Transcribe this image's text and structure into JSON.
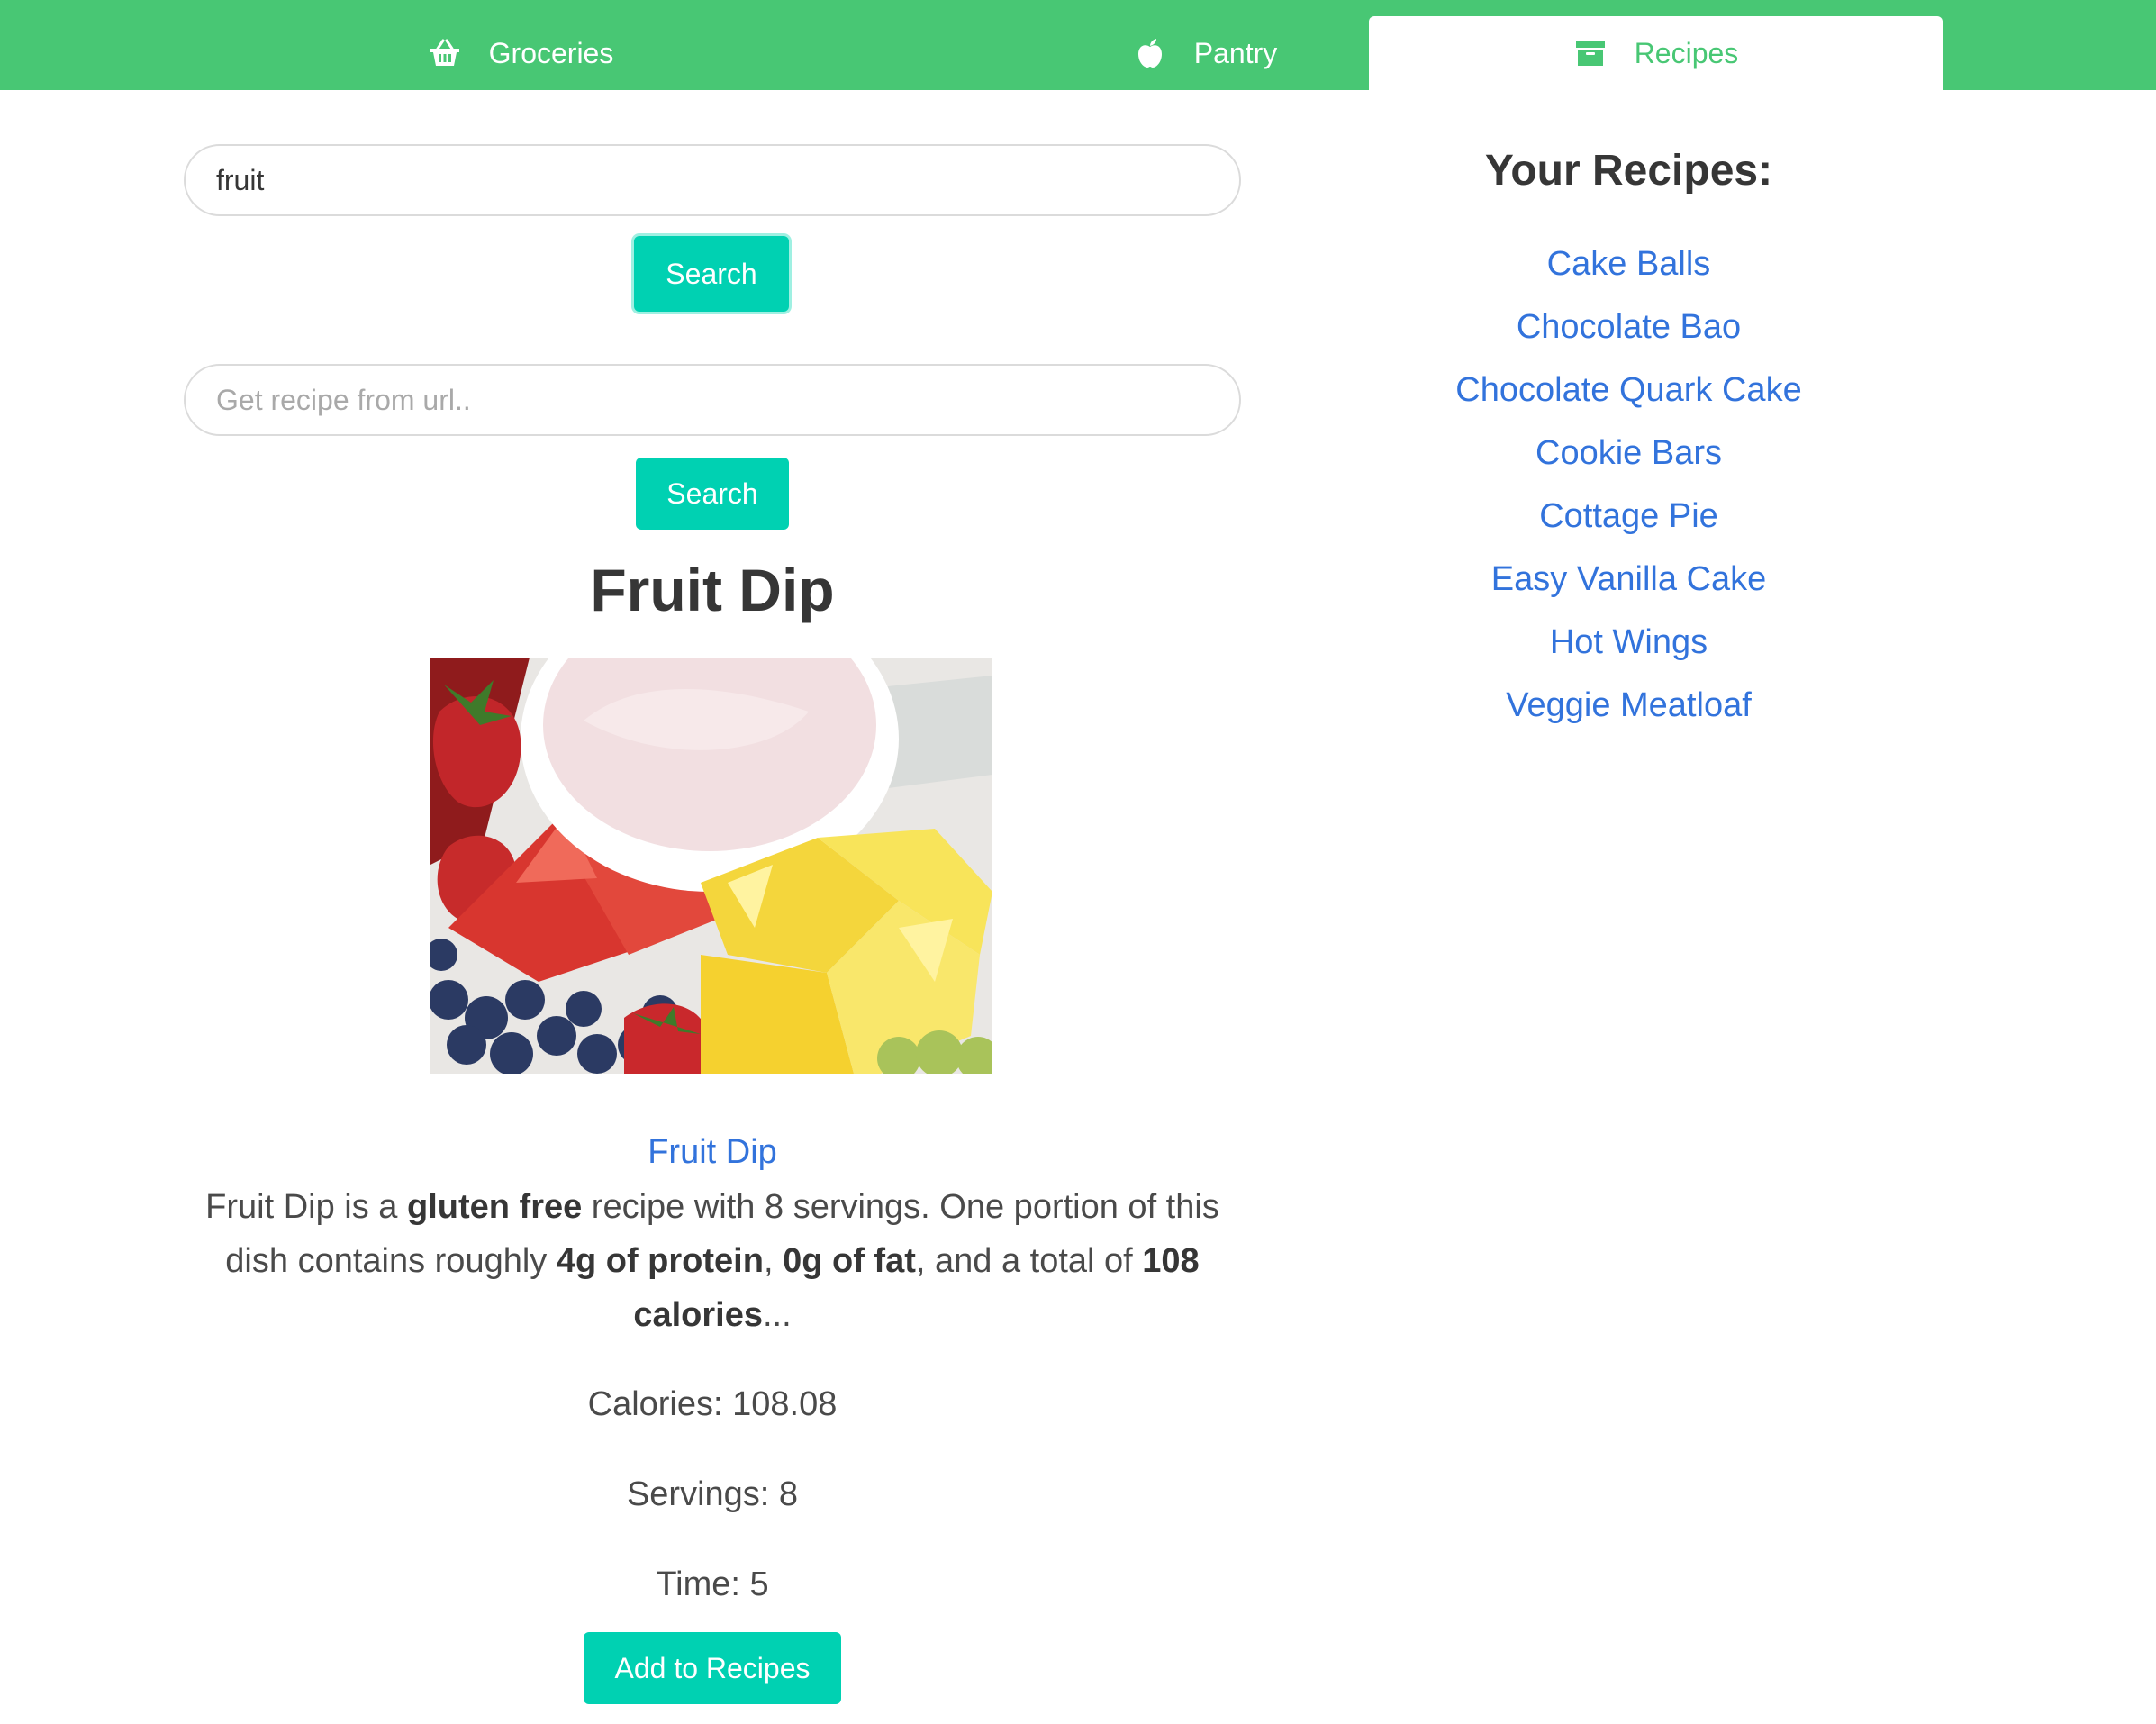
{
  "nav": {
    "tabs": [
      {
        "label": "Groceries",
        "icon": "basket-icon",
        "active": false
      },
      {
        "label": "Pantry",
        "icon": "apple-icon",
        "active": false
      },
      {
        "label": "Recipes",
        "icon": "archive-icon",
        "active": true
      }
    ]
  },
  "search": {
    "value": "fruit",
    "button_label": "Search"
  },
  "url_search": {
    "value": "",
    "placeholder": "Get recipe from url..",
    "button_label": "Search"
  },
  "recipe": {
    "title": "Fruit Dip",
    "image_alt": "fruit-dip-photo",
    "link_label": "Fruit Dip",
    "summary": {
      "t1": "Fruit Dip is a ",
      "b1": "gluten free",
      "t2": " recipe with 8 servings. One portion of this dish contains roughly ",
      "b2": "4g of protein",
      "t3": ", ",
      "b3": "0g of fat",
      "t4": ", and a total of ",
      "b4": "108 calories",
      "t5": "..."
    },
    "calories": "Calories: 108.08",
    "servings": "Servings: 8",
    "time": "Time: 5",
    "add_button_label": "Add to Recipes"
  },
  "saved": {
    "heading": "Your Recipes:",
    "items": [
      "Cake Balls",
      "Chocolate Bao",
      "Chocolate Quark Cake",
      "Cookie Bars",
      "Cottage Pie",
      "Easy Vanilla Cake",
      "Hot Wings",
      "Veggie Meatloaf"
    ]
  },
  "colors": {
    "nav_green": "#48c774",
    "button_teal": "#00d1b2",
    "link_blue": "#3273dc"
  }
}
